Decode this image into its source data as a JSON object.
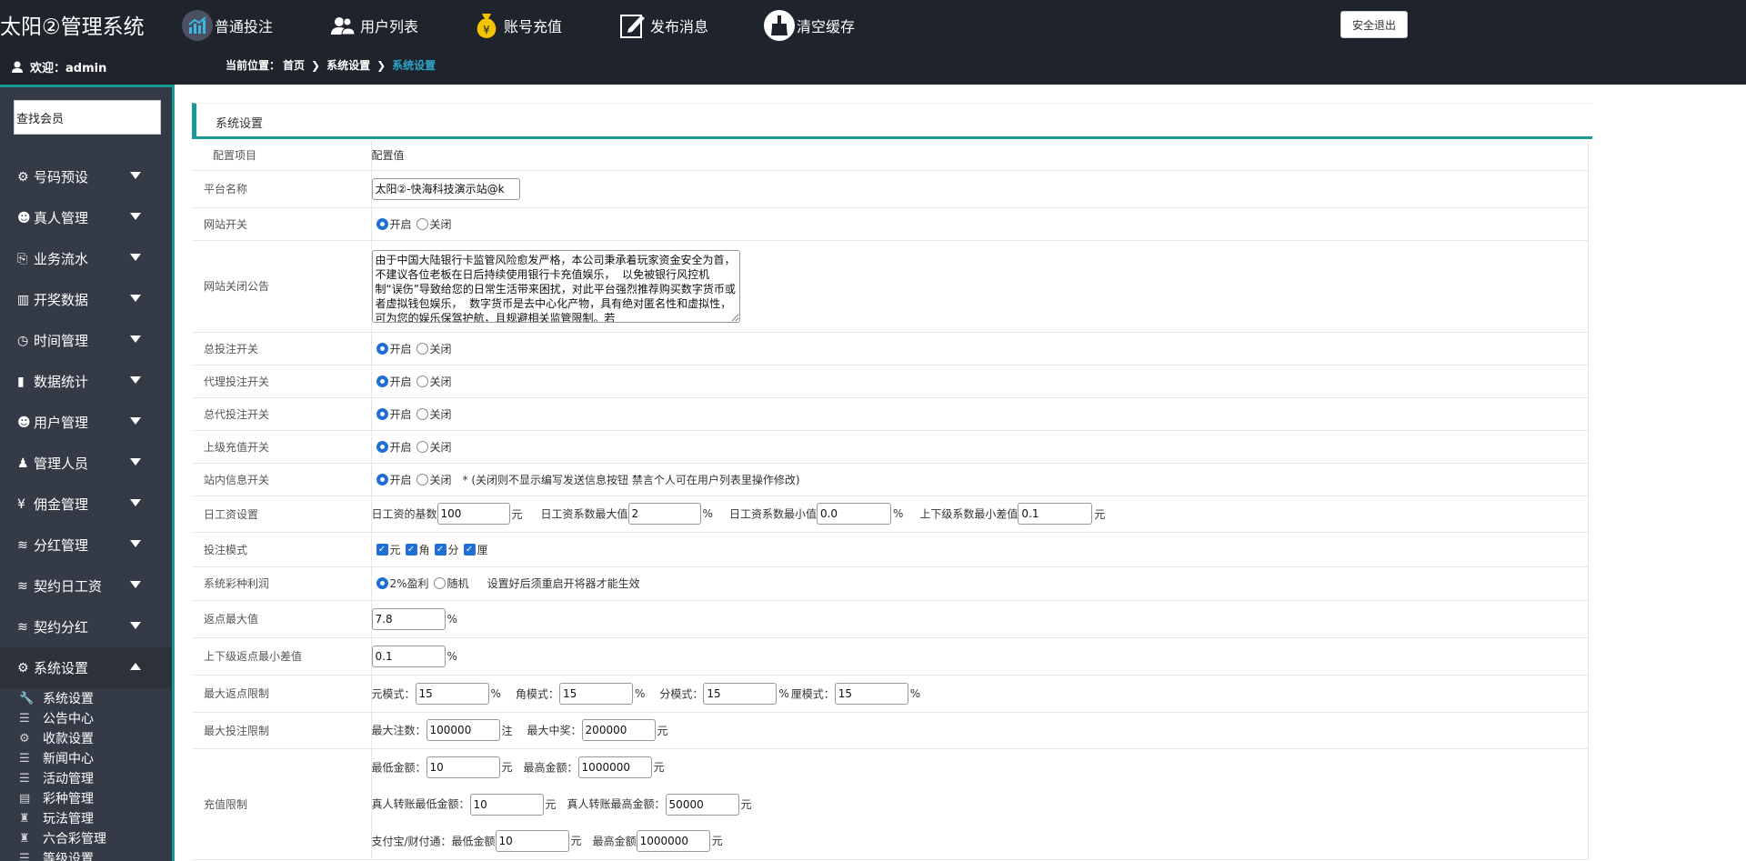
{
  "app": {
    "title": "太阳②管理系统",
    "logout": "安全退出",
    "welcome": "欢迎：admin"
  },
  "nav": [
    {
      "label": "普通投注",
      "icon": "bar-chart-icon"
    },
    {
      "label": "用户列表",
      "icon": "users-icon"
    },
    {
      "label": "账号充值",
      "icon": "money-bag-icon"
    },
    {
      "label": "发布消息",
      "icon": "edit-icon"
    },
    {
      "label": "清空缓存",
      "icon": "broom-icon"
    }
  ],
  "breadcrumb": {
    "prefix": "当前位置：",
    "home": "首页",
    "parent": "系统设置",
    "current": "系统设置"
  },
  "sidebar": {
    "search": "查找会员",
    "menus": [
      {
        "label": "号码预设",
        "icon": "gear-icon"
      },
      {
        "label": "真人管理",
        "icon": "user-group-icon"
      },
      {
        "label": "业务流水",
        "icon": "flow-icon"
      },
      {
        "label": "开奖数据",
        "icon": "chart-icon"
      },
      {
        "label": "时间管理",
        "icon": "clock-icon"
      },
      {
        "label": "数据统计",
        "icon": "stats-icon"
      },
      {
        "label": "用户管理",
        "icon": "users-icon"
      },
      {
        "label": "管理人员",
        "icon": "user-icon"
      },
      {
        "label": "佣金管理",
        "icon": "yen-icon"
      },
      {
        "label": "分红管理",
        "icon": "database-icon"
      },
      {
        "label": "契约日工资",
        "icon": "database-icon"
      },
      {
        "label": "契约分红",
        "icon": "database-icon"
      },
      {
        "label": "系统设置",
        "icon": "settings-icon"
      }
    ],
    "submenu": [
      {
        "label": "系统设置",
        "icon": "wrench-icon"
      },
      {
        "label": "公告中心",
        "icon": "list-icon"
      },
      {
        "label": "收款设置",
        "icon": "gear-icon"
      },
      {
        "label": "新闻中心",
        "icon": "list-icon"
      },
      {
        "label": "活动管理",
        "icon": "list-icon"
      },
      {
        "label": "彩种管理",
        "icon": "archive-icon"
      },
      {
        "label": "玩法管理",
        "icon": "game-icon"
      },
      {
        "label": "六合彩管理",
        "icon": "game-icon"
      },
      {
        "label": "等级设置",
        "icon": "list-icon"
      }
    ]
  },
  "panel": {
    "title": "系统设置"
  },
  "table": {
    "col1": "配置项目",
    "col2": "配置值",
    "platform_name": {
      "label": "平台名称",
      "value": "太阳②-快海科技演示站@k"
    },
    "site_switch": {
      "label": "网站开关"
    },
    "on": "开启",
    "off": "关闭",
    "close_notice": {
      "label": "网站关闭公告",
      "value": "由于中国大陆银行卡监管风险愈发严格，本公司秉承着玩家资金安全为首，不建议各位老板在日后持续使用银行卡充值娱乐，  以免被银行风控机制“误伤”导致给您的日常生活带来困扰，对此平台强烈推荐购买数字货币或者虚拟钱包娱乐，  数字货币是去中心化产物，具有绝对匿名性和虚拟性，可为您的娱乐保驾护航，且规避相关监管限制。若"
    },
    "total_bet_switch": {
      "label": "总投注开关"
    },
    "agent_bet_switch": {
      "label": "代理投注开关"
    },
    "gen_agent_bet_switch": {
      "label": "总代投注开关"
    },
    "upper_recharge_switch": {
      "label": "上级充值开关"
    },
    "msg_switch": {
      "label": "站内信息开关",
      "note": "*  (关闭则不显示编写发送信息按钮 禁言个人可在用户列表里操作修改)"
    },
    "daily_wage": {
      "label": "日工资设置",
      "base_label": "日工资的基数",
      "base": "100",
      "unit_yuan": "元",
      "max_label": "日工资系数最大值",
      "max": "2",
      "pct": "%",
      "min_label": "日工资系数最小值",
      "min": "0.0",
      "diff_label": "上下级系数最小差值",
      "diff": "0.1"
    },
    "bet_mode": {
      "label": "投注模式",
      "modes": [
        "元",
        "角",
        "分",
        "厘"
      ]
    },
    "profit": {
      "label": "系统彩种利润",
      "opt1": "2%盈利",
      "opt2": "随机",
      "note": "设置好后须重启开将器才能生效"
    },
    "rebate_max": {
      "label": "返点最大值",
      "value": "7.8",
      "unit": "%"
    },
    "rebate_diff": {
      "label": "上下级返点最小差值",
      "value": "0.1",
      "unit": "%"
    },
    "max_rebate_limit": {
      "label": "最大返点限制",
      "yuan_label": "元模式：",
      "yuan": "15",
      "jiao_label": "角模式：",
      "jiao": "15",
      "fen_label": "分模式：",
      "fen": "15",
      "li_label": "厘模式：",
      "li": "15",
      "unit": "%"
    },
    "max_bet_limit": {
      "label": "最大投注限制",
      "count_label": "最大注数：",
      "count": "100000",
      "count_unit": "注",
      "win_label": "最大中奖：",
      "win": "200000",
      "win_unit": "元"
    },
    "recharge_limit": {
      "label": "充值限制",
      "min_label": "最低金额：",
      "min": "10",
      "max_label": "最高金额：",
      "max": "1000000",
      "live_min_label": "真人转账最低金额：",
      "live_min": "10",
      "live_max_label": "真人转账最高金额：",
      "live_max": "50000",
      "pay_label": "支付宝/财付通：最低金额",
      "pay_min": "10",
      "pay_max_label": "最高金额",
      "pay_max": "1000000",
      "unit": "元"
    }
  }
}
